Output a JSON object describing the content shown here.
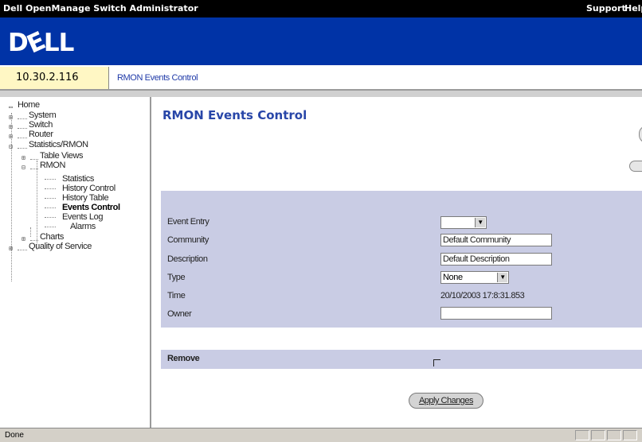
{
  "window": {
    "title": "Dell OpenManage Switch Administrator",
    "support_label": "Support",
    "help_label": "Help"
  },
  "brand": {
    "logo": "DELL"
  },
  "header": {
    "ip_address": "10.30.2.116",
    "breadcrumb": "RMON Events Control"
  },
  "nav": {
    "home": "Home",
    "system": "System",
    "switch": "Switch",
    "router": "Router",
    "stats_rmon": "Statistics/RMON",
    "table_views": "Table Views",
    "rmon": "RMON",
    "statistics": "Statistics",
    "history_control": "History Control",
    "history_table": "History Table",
    "events_control": "Events Control",
    "events_log": "Events Log",
    "alarms": "Alarms",
    "charts": "Charts",
    "qos": "Quality of Service"
  },
  "main": {
    "page_title": "RMON Events Control",
    "fields": {
      "event_entry_label": "Event Entry",
      "event_entry_value": "",
      "community_label": "Community",
      "community_value": "Default Community",
      "description_label": "Description",
      "description_value": "Default Description",
      "type_label": "Type",
      "type_value": "None",
      "time_label": "Time",
      "time_value": "20/10/2003 17:8:31.853",
      "owner_label": "Owner",
      "owner_value": ""
    },
    "remove_label": "Remove",
    "apply_label": "Apply Changes"
  },
  "status": {
    "text": "Done"
  },
  "colors": {
    "title_bar": "#000000",
    "brand_band": "#0033a6",
    "panel": "#c9cce4",
    "page_title": "#2846a8",
    "ip_bar": "#fff7c4"
  }
}
